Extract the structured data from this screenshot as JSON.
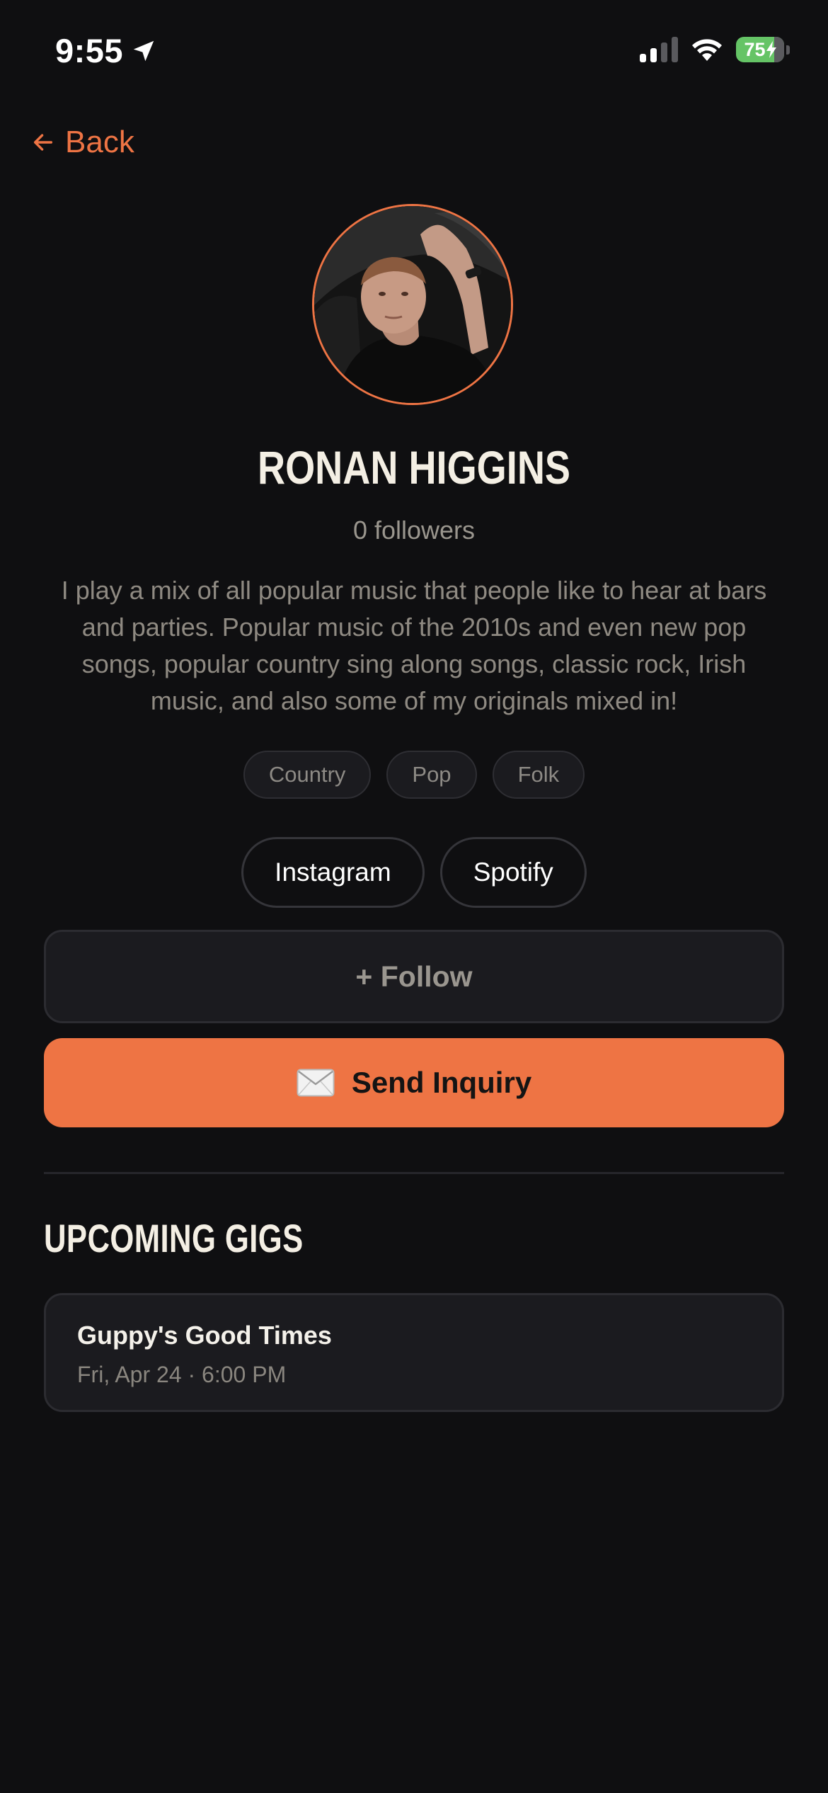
{
  "status_bar": {
    "time": "9:55",
    "battery_percent": "75",
    "battery_level": 0.75,
    "battery_color": "#65c466",
    "icons": [
      "location-arrow-icon",
      "cellular-signal-icon",
      "wifi-icon",
      "battery-charging-icon"
    ]
  },
  "nav": {
    "back_label": "Back",
    "back_icon": "arrow-left-icon"
  },
  "profile": {
    "name": "RONAN HIGGINS",
    "followers": "0 followers",
    "bio": "I play a mix of all popular music that people like to hear at bars and parties. Popular music of the 2010s and even new pop songs, popular country sing along songs, classic rock, Irish music, and also some of my originals mixed in!",
    "genres": [
      "Country",
      "Pop",
      "Folk"
    ],
    "socials": [
      "Instagram",
      "Spotify"
    ]
  },
  "actions": {
    "follow_label": "+ Follow",
    "inquiry_label": "Send Inquiry",
    "inquiry_icon": "envelope-icon"
  },
  "gigs": {
    "title": "UPCOMING GIGS",
    "items": [
      {
        "venue": "Guppy's Good Times",
        "when": "Fri, Apr 24 · 6:00 PM"
      }
    ]
  },
  "colors": {
    "background": "#0f0f11",
    "accent": "#ee7444",
    "card": "#1b1b1f",
    "muted_text": "#8f8a82"
  }
}
